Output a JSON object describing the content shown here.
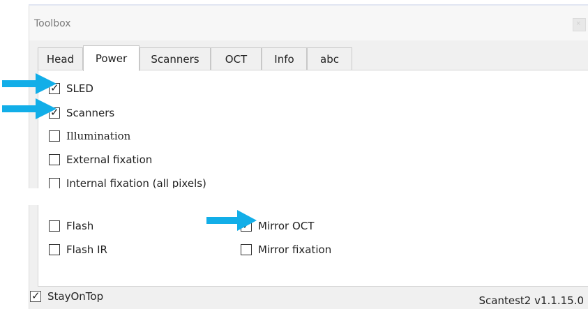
{
  "window": {
    "title": "Toolbox",
    "close_glyph": "×"
  },
  "tabs": [
    {
      "label": "Head",
      "active": false
    },
    {
      "label": "Power",
      "active": true
    },
    {
      "label": "Scanners",
      "active": false
    },
    {
      "label": "OCT",
      "active": false
    },
    {
      "label": "Info",
      "active": false
    },
    {
      "label": "abc",
      "active": false
    }
  ],
  "power_options": [
    {
      "label": "SLED",
      "checked": true
    },
    {
      "label": "Scanners",
      "checked": true
    },
    {
      "label": "Illumination",
      "checked": false
    },
    {
      "label": "External fixation",
      "checked": false
    },
    {
      "label": "Internal fixation (all pixels)",
      "checked": false
    }
  ],
  "lower_left_options": [
    {
      "label": "Flash",
      "checked": false
    },
    {
      "label": "Flash IR",
      "checked": false
    }
  ],
  "lower_right_options": [
    {
      "label": "Mirror OCT",
      "checked": true
    },
    {
      "label": "Mirror fixation",
      "checked": false
    }
  ],
  "footer": {
    "stay_on_top": {
      "label": "StayOnTop",
      "checked": true
    },
    "version": "Scantest2 v1.1.15.0"
  },
  "colors": {
    "annotation_arrow": "#12aee8",
    "window_bg": "#f0f0f0",
    "panel_bg": "#ffffff"
  },
  "icons": {
    "annotation": "arrow-right-icon",
    "checkbox_checked": "check-icon",
    "close": "close-icon"
  },
  "check_glyph": "✓"
}
